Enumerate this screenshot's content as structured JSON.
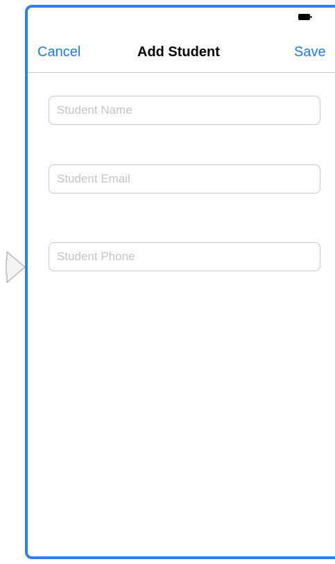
{
  "nav": {
    "cancel_label": "Cancel",
    "title": "Add Student",
    "save_label": "Save"
  },
  "form": {
    "name_placeholder": "Student Name",
    "email_placeholder": "Student Email",
    "phone_placeholder": "Student Phone"
  },
  "status_bar": {
    "battery_icon": "battery-icon"
  },
  "storyboard": {
    "entry_icon": "initial-view-controller-arrow-icon"
  },
  "colors": {
    "accent": "#1a7cf2",
    "frame": "#2f7ff0",
    "separator": "#c8c7cc",
    "placeholder": "#c4c4c9"
  }
}
